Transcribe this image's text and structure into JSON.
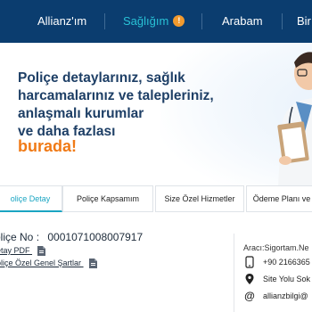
{
  "nav": {
    "items": [
      {
        "label": "Allianz'ım"
      },
      {
        "label": "Sağlığım",
        "badge": "!"
      },
      {
        "label": "Arabam"
      },
      {
        "label": "Bir"
      }
    ]
  },
  "hero": {
    "lines": [
      "Poliçe detaylarınız, sağlık",
      "harcamalarınız ve talepleriniz,",
      "anlaşmalı kurumlar",
      "ve daha fazlası"
    ],
    "highlight": "burada!"
  },
  "tabs": [
    {
      "label": "oliçe Detay"
    },
    {
      "label": "Poliçe Kapsamım"
    },
    {
      "label": "Size Özel Hizmetler"
    },
    {
      "label": "Ödeme Planı ve"
    }
  ],
  "policy": {
    "label": "oliçe No :",
    "number": "0001071008007917",
    "links": [
      {
        "label": "etay PDF"
      },
      {
        "label": "oliçe Özel Genel Şartlar"
      }
    ]
  },
  "agent": {
    "label": "Aracı:Sigortam.Ne",
    "phone": "+90 2166365",
    "address": "Site Yolu Sok",
    "email": "allianzbilgi@"
  },
  "colors": {
    "nav_bg": "#0b3d6f",
    "accent": "#29c2d6",
    "highlight": "#f07a16",
    "heading": "#1e3f66"
  }
}
